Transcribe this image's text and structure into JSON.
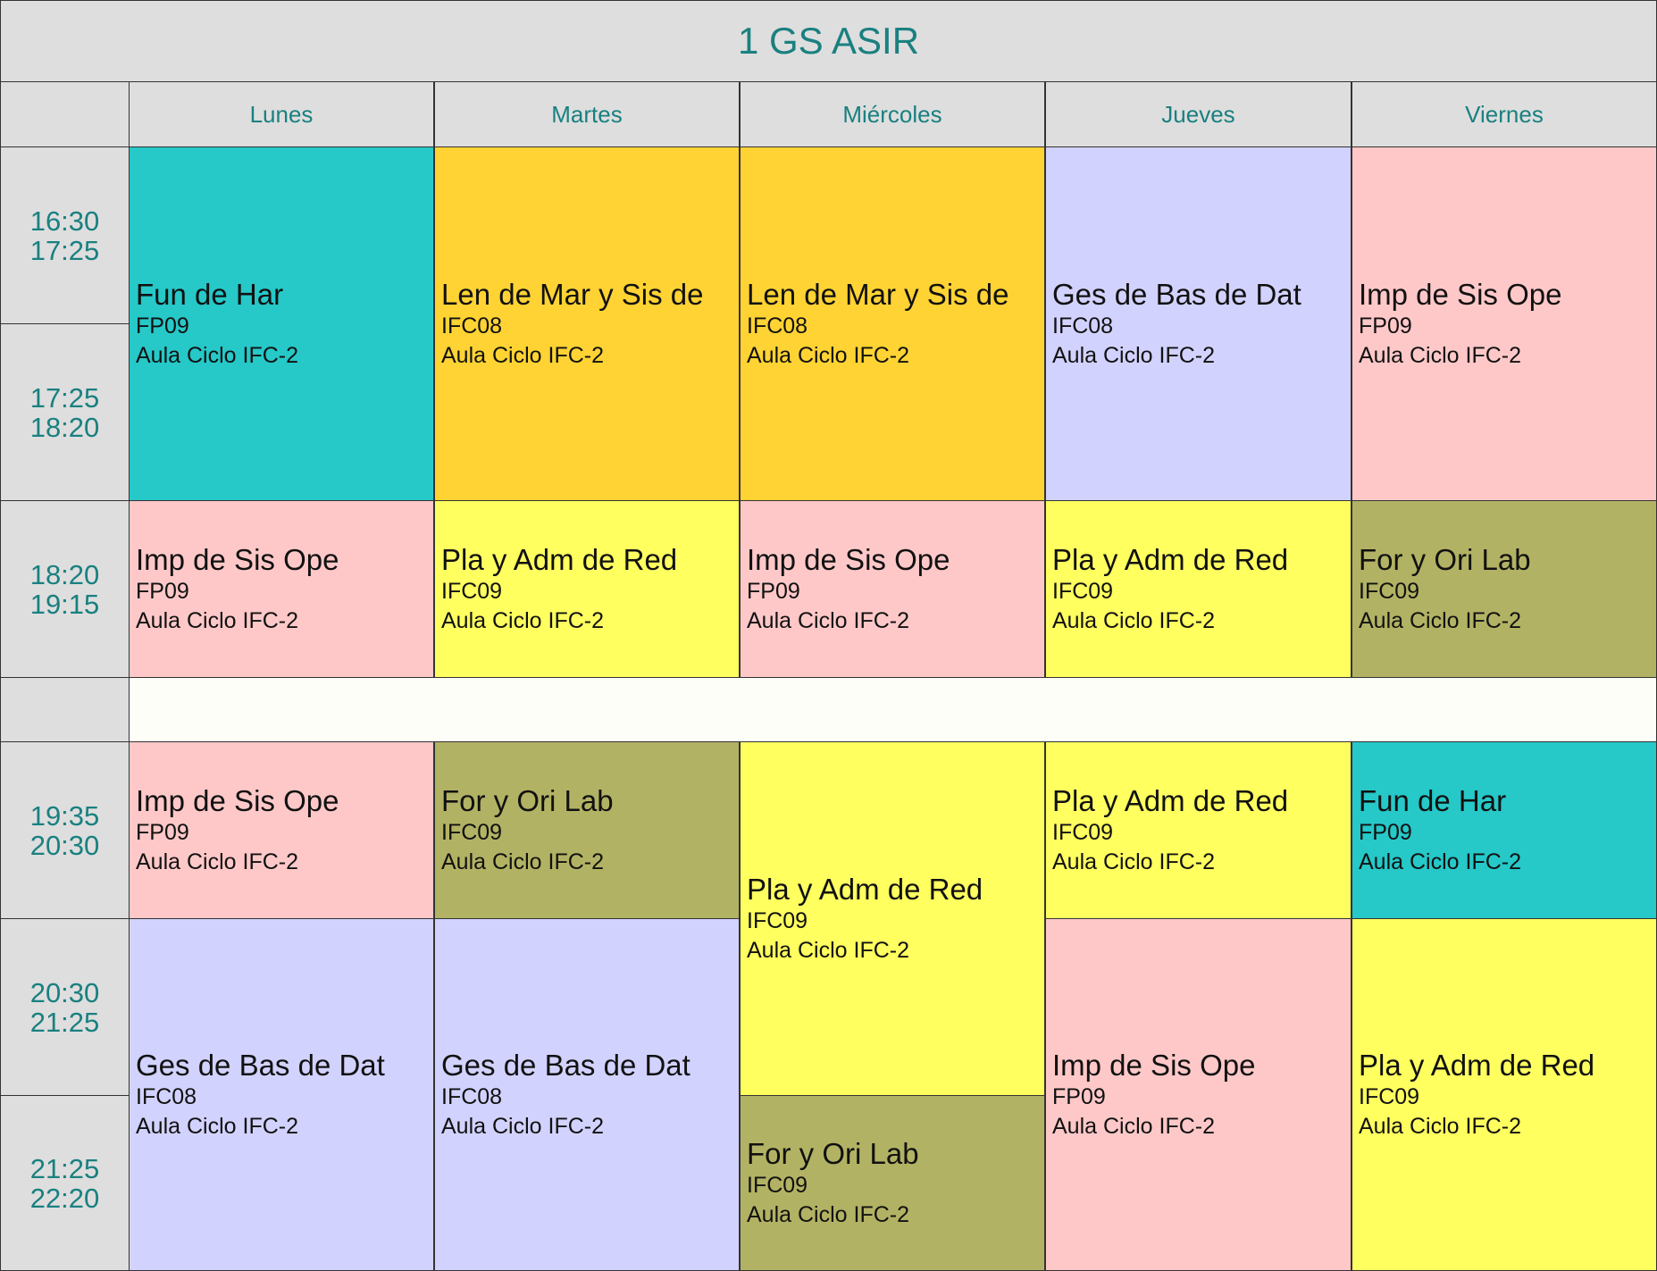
{
  "timetable": {
    "title": "1 GS ASIR",
    "days": [
      "Lunes",
      "Martes",
      "Miércoles",
      "Jueves",
      "Viernes"
    ],
    "slots": [
      {
        "start": "16:30",
        "end": "17:25"
      },
      {
        "start": "17:25",
        "end": "18:20"
      },
      {
        "start": "18:20",
        "end": "19:15"
      },
      {
        "start": "",
        "end": "",
        "is_break": true
      },
      {
        "start": "19:35",
        "end": "20:30"
      },
      {
        "start": "20:30",
        "end": "21:25"
      },
      {
        "start": "21:25",
        "end": "22:20"
      }
    ],
    "colors": {
      "Fun de Har": "#26c8c8",
      "Len de Mar y Sis de": "#ffd333",
      "Ges de Bas de Dat": "#d2d2ff",
      "Imp de Sis Ope": "#ffc8c8",
      "Pla y Adm de Red": "#ffff60",
      "For y Ori Lab": "#b2b264"
    },
    "sessions": [
      {
        "day": 0,
        "slot": 0,
        "span": 2,
        "subject": "Fun de Har",
        "group": "FP09",
        "room": "Aula Ciclo IFC-2"
      },
      {
        "day": 1,
        "slot": 0,
        "span": 2,
        "subject": "Len de Mar y Sis de",
        "group": "IFC08",
        "room": "Aula Ciclo IFC-2"
      },
      {
        "day": 2,
        "slot": 0,
        "span": 2,
        "subject": "Len de Mar y Sis de",
        "group": "IFC08",
        "room": "Aula Ciclo IFC-2"
      },
      {
        "day": 3,
        "slot": 0,
        "span": 2,
        "subject": "Ges de Bas de Dat",
        "group": "IFC08",
        "room": "Aula Ciclo IFC-2"
      },
      {
        "day": 4,
        "slot": 0,
        "span": 2,
        "subject": "Imp de Sis Ope",
        "group": "FP09",
        "room": "Aula Ciclo IFC-2"
      },
      {
        "day": 0,
        "slot": 2,
        "span": 1,
        "subject": "Imp de Sis Ope",
        "group": "FP09",
        "room": "Aula Ciclo IFC-2"
      },
      {
        "day": 1,
        "slot": 2,
        "span": 1,
        "subject": "Pla y Adm de Red",
        "group": "IFC09",
        "room": "Aula Ciclo IFC-2"
      },
      {
        "day": 2,
        "slot": 2,
        "span": 1,
        "subject": "Imp de Sis Ope",
        "group": "FP09",
        "room": "Aula Ciclo IFC-2"
      },
      {
        "day": 3,
        "slot": 2,
        "span": 1,
        "subject": "Pla y Adm de Red",
        "group": "IFC09",
        "room": "Aula Ciclo IFC-2"
      },
      {
        "day": 4,
        "slot": 2,
        "span": 1,
        "subject": "For y Ori Lab",
        "group": "IFC09",
        "room": "Aula Ciclo IFC-2"
      },
      {
        "day": 0,
        "slot": 4,
        "span": 1,
        "subject": "Imp de Sis Ope",
        "group": "FP09",
        "room": "Aula Ciclo IFC-2"
      },
      {
        "day": 1,
        "slot": 4,
        "span": 1,
        "subject": "For y Ori Lab",
        "group": "IFC09",
        "room": "Aula Ciclo IFC-2"
      },
      {
        "day": 2,
        "slot": 4,
        "span": 2,
        "subject": "Pla y Adm de Red",
        "group": "IFC09",
        "room": "Aula Ciclo IFC-2"
      },
      {
        "day": 3,
        "slot": 4,
        "span": 1,
        "subject": "Pla y Adm de Red",
        "group": "IFC09",
        "room": "Aula Ciclo IFC-2"
      },
      {
        "day": 4,
        "slot": 4,
        "span": 1,
        "subject": "Fun de Har",
        "group": "FP09",
        "room": "Aula Ciclo IFC-2"
      },
      {
        "day": 0,
        "slot": 5,
        "span": 2,
        "subject": "Ges de Bas de Dat",
        "group": "IFC08",
        "room": "Aula Ciclo IFC-2"
      },
      {
        "day": 1,
        "slot": 5,
        "span": 2,
        "subject": "Ges de Bas de Dat",
        "group": "IFC08",
        "room": "Aula Ciclo IFC-2"
      },
      {
        "day": 3,
        "slot": 5,
        "span": 2,
        "subject": "Imp de Sis Ope",
        "group": "FP09",
        "room": "Aula Ciclo IFC-2"
      },
      {
        "day": 4,
        "slot": 5,
        "span": 2,
        "subject": "Pla y Adm de Red",
        "group": "IFC09",
        "room": "Aula Ciclo IFC-2"
      },
      {
        "day": 2,
        "slot": 6,
        "span": 1,
        "subject": "For y Ori Lab",
        "group": "IFC09",
        "room": "Aula Ciclo IFC-2"
      }
    ]
  }
}
